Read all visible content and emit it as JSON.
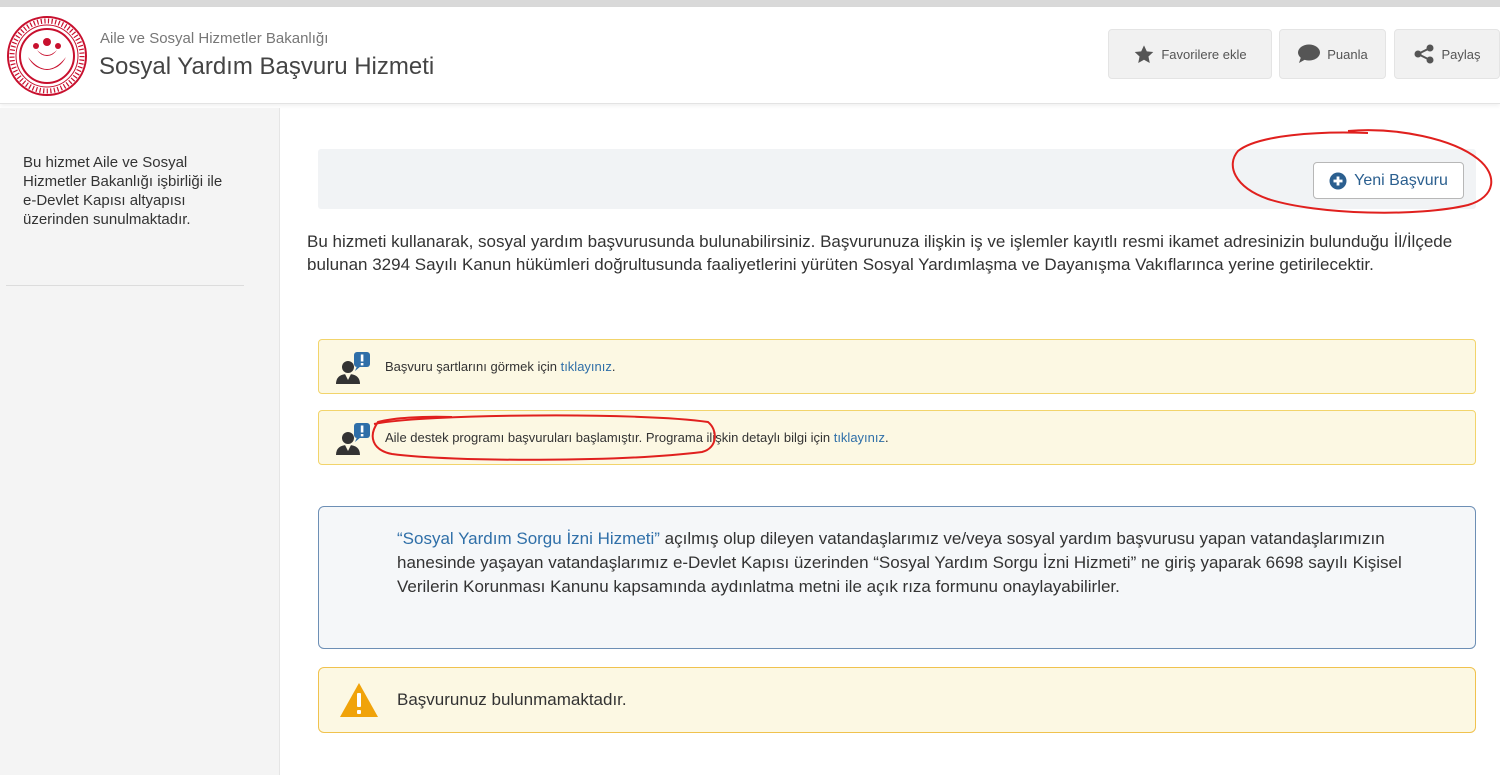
{
  "header": {
    "ministry": "Aile ve Sosyal Hizmetler Bakanlığı",
    "title": "Sosyal Yardım Başvuru Hizmeti",
    "favorite_label": "Favorilere ekle",
    "rate_label": "Puanla",
    "share_label": "Paylaş"
  },
  "sidebar": {
    "text": "Bu hizmet Aile ve Sosyal Hizmetler Bakanlığı işbirliği ile e-Devlet Kapısı altyapısı üzerinden sunulmaktadır."
  },
  "actions": {
    "new_application_label": "Yeni Başvuru"
  },
  "description": "Bu hizmeti kullanarak, sosyal yardım başvurusunda bulunabilirsiniz. Başvurunuza ilişkin iş ve işlemler kayıtlı resmi ikamet adresinizin bulunduğu İl/İlçede bulunan 3294 Sayılı Kanun hükümleri doğrultusunda faaliyetlerini yürüten Sosyal Yardımlaşma ve Dayanışma Vakıflarınca yerine getirilecektir.",
  "notices": [
    {
      "text": "Başvuru şartlarını görmek için ",
      "link": "tıklayınız",
      "suffix": "."
    },
    {
      "highlight": "Aile destek programı başvuruları başlamıştır.",
      "text": " Programa ilişkin detaylı bilgi için ",
      "link": "tıklayınız",
      "suffix": "."
    }
  ],
  "info": {
    "quoted": "“Sosyal Yardım Sorgu İzni Hizmeti”",
    "text": " açılmış olup dileyen vatandaşlarımız ve/veya sosyal yardım başvurusu yapan vatandaşlarımızın hanesinde yaşayan vatandaşlarımız e-Devlet Kapısı üzerinden “Sosyal Yardım Sorgu İzni Hizmeti” ne giriş yaparak 6698 sayılı Kişisel Verilerin Korunması Kanunu kapsamında aydınlatma metni ile açık rıza formunu onaylayabilirler."
  },
  "warning": {
    "text": "Başvurunuz bulunmamaktadır."
  },
  "colors": {
    "logo_red": "#c8102e",
    "link_blue": "#2f6fa8",
    "notice_bg": "#fcf8e3",
    "annotation_red": "#e0201e"
  }
}
